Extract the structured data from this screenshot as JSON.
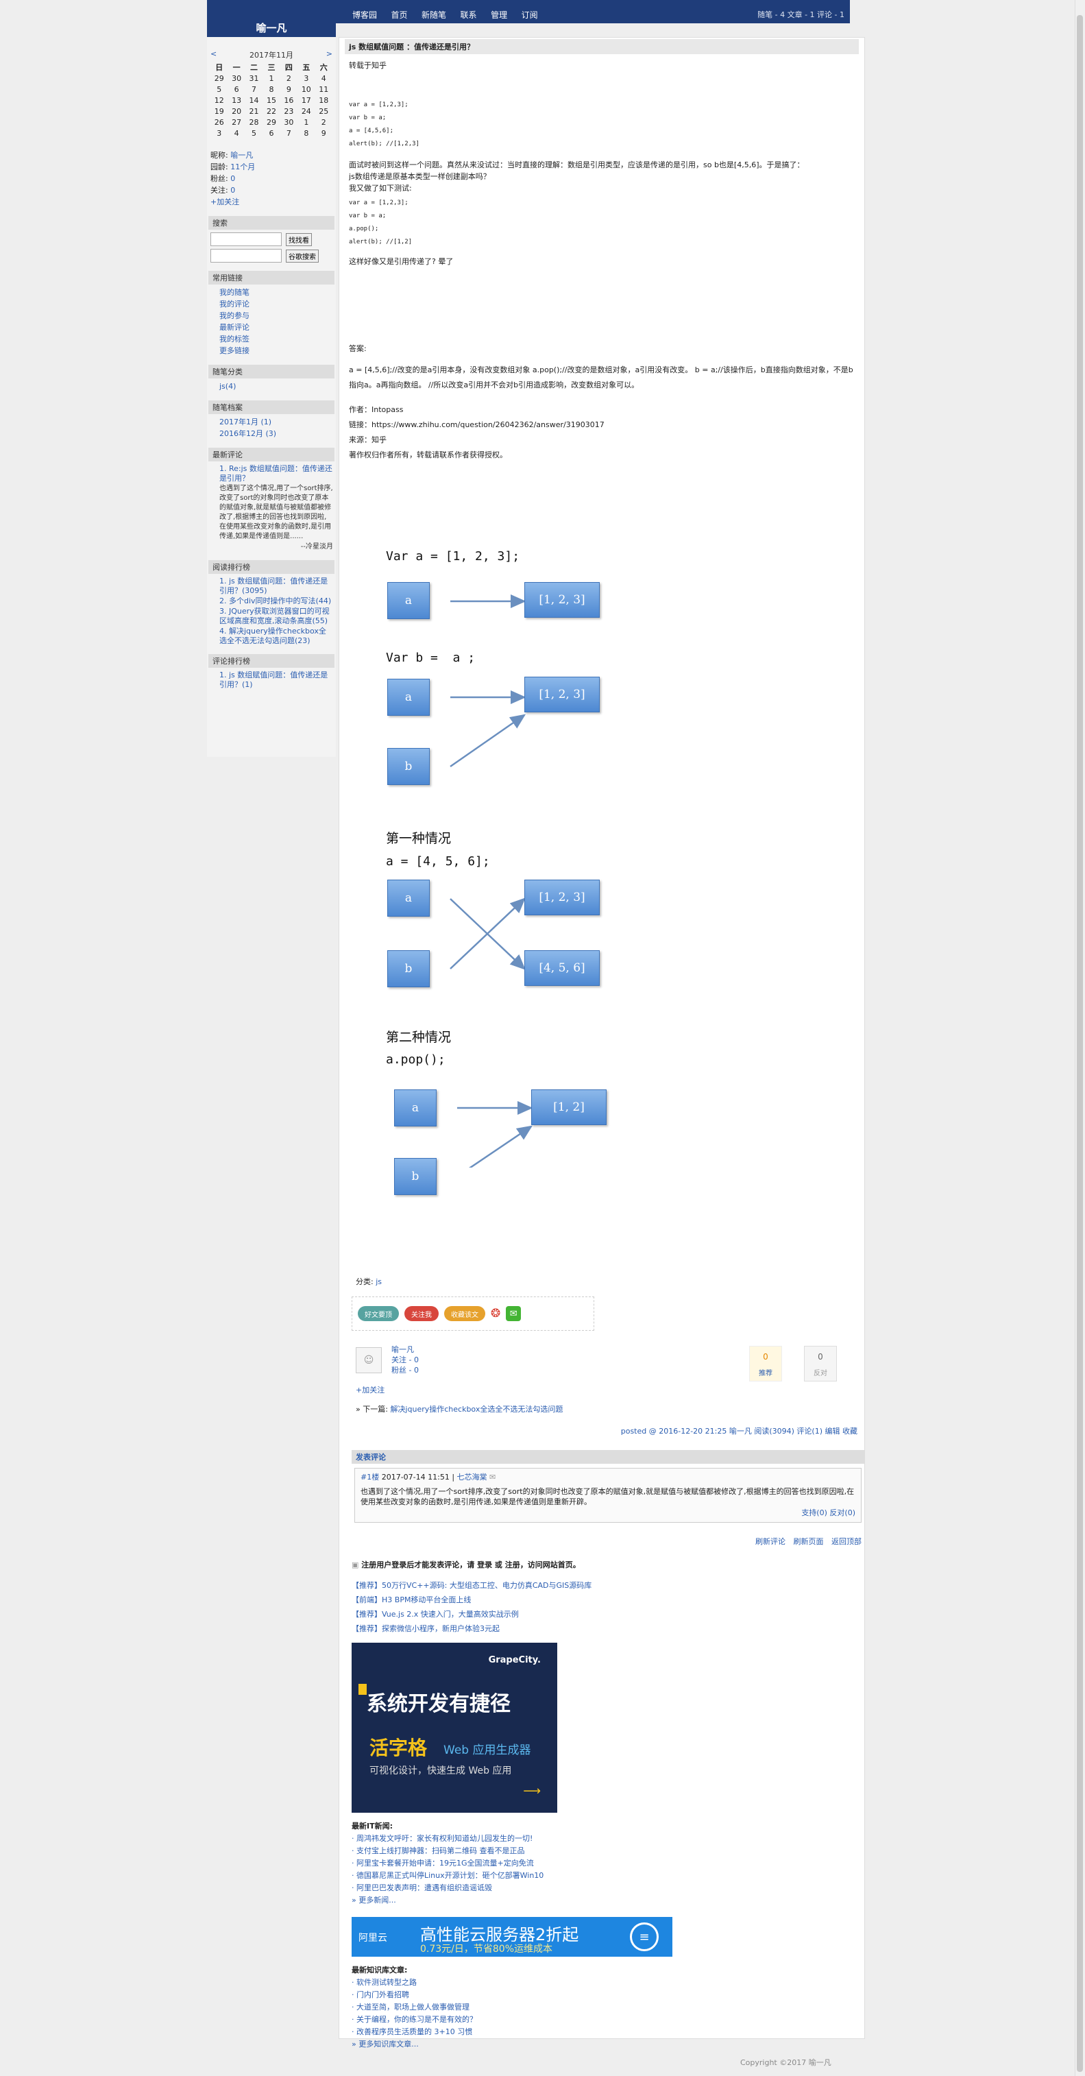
{
  "header": {
    "blog_name": "喻一凡",
    "nav": [
      "博客园",
      "首页",
      "新随笔",
      "联系",
      "管理",
      "订阅"
    ],
    "stats": "随笔 - 4  文章 - 1  评论 - 1"
  },
  "calendar": {
    "prev": "<",
    "next": ">",
    "month": "2017年11月",
    "weekdays": [
      "日",
      "一",
      "二",
      "三",
      "四",
      "五",
      "六"
    ],
    "rows": [
      [
        "29",
        "30",
        "31",
        "1",
        "2",
        "3",
        "4"
      ],
      [
        "5",
        "6",
        "7",
        "8",
        "9",
        "10",
        "11"
      ],
      [
        "12",
        "13",
        "14",
        "15",
        "16",
        "17",
        "18"
      ],
      [
        "19",
        "20",
        "21",
        "22",
        "23",
        "24",
        "25"
      ],
      [
        "26",
        "27",
        "28",
        "29",
        "30",
        "1",
        "2"
      ],
      [
        "3",
        "4",
        "5",
        "6",
        "7",
        "8",
        "9"
      ]
    ]
  },
  "profile": {
    "nick_label": "昵称:",
    "nick": "喻一凡",
    "age_label": "园龄:",
    "age": "11个月",
    "fans_label": "粉丝:",
    "fans": "0",
    "follow_label": "关注:",
    "follow": "0",
    "add_follow": "+加关注"
  },
  "search": {
    "title": "搜索",
    "btn1": "找找看",
    "btn2": "谷歌搜索"
  },
  "links": {
    "title": "常用链接",
    "items": [
      "我的随笔",
      "我的评论",
      "我的参与",
      "最新评论",
      "我的标签",
      "更多链接"
    ]
  },
  "cats": {
    "title": "随笔分类",
    "items": [
      "js(4)"
    ]
  },
  "archive": {
    "title": "随笔档案",
    "items": [
      "2017年1月 (1)",
      "2016年12月 (3)"
    ]
  },
  "recent": {
    "title": "最新评论",
    "link": "1. Re:js 数组赋值问题：值传递还是引用？",
    "text": "也遇到了这个情况,用了一个sort排序,改变了sort的对象同时也改变了原本的赋值对象,就是赋值与被赋值都被修改了,根据博主的回答也找到原因啦,在使用某些改变对象的函数时,是引用传递,如果是传递值则是......",
    "author": "--冷星淡月"
  },
  "top_read": {
    "title": "阅读排行榜",
    "items": [
      "1. js 数组赋值问题：值传递还是引用？(3095)",
      "2. 多个div同时操作中的写法(44)",
      "3. JQuery获取浏览器窗口的可视区域高度和宽度,滚动条高度(55)",
      "4. 解决jquery操作checkbox全选全不选无法勾选问题(23)"
    ]
  },
  "top_comment": {
    "title": "评论排行榜",
    "items": [
      "1. js 数组赋值问题：值传递还是引用？(1)"
    ]
  },
  "post": {
    "title": "js 数组赋值问题 ：值传递还是引用？",
    "source": "转载于知乎",
    "code1": [
      "var a = [1,2,3];",
      "var b = a;",
      "a = [4,5,6];",
      "alert(b);  //[1,2,3]"
    ],
    "para1": "面试时被问到这样一个问题。真然从来没试过：当时直接的理解：数组是引用类型，应该是传递的是引用，so b也是[4,5,6]。于是搞了：",
    "para1b": "js数组传递是原基本类型一样创建副本吗？",
    "para2": "我又做了如下测试:",
    "code2": [
      "var a = [1,2,3];",
      "var b = a;",
      "a.pop();",
      "alert(b);  //[1,2]"
    ],
    "para3": "这样好像又是引用传递了? 晕了",
    "answer_label": "答案:",
    "answer": "a = [4,5,6];//改变的是a引用本身，没有改变数组对象 a.pop();//改变的是数组对象，a引用没有改变。 b = a;//该操作后，b直接指向数组对象，不是b指向a。a再指向数组。 //所以改变a引用并不会对b引用造成影响，改变数组对象可以。",
    "author_line": "作者：Intopass",
    "link_line": "链接：https://www.zhihu.com/question/26042362/answer/31903017",
    "from_line": "来源：知乎",
    "copyright_line": "著作权归作者所有，转载请联系作者获得授权。",
    "category_label": "分类:",
    "category": "js"
  },
  "diagram": {
    "line1": "Var a = [1, 2, 3];",
    "line2": "Var b =  a ;",
    "case1": "第一种情况",
    "case1code": "a = [4, 5, 6];",
    "case2": "第二种情况",
    "case2code": "a.pop();",
    "box_a": "a",
    "box_b": "b",
    "arr1": "[1, 2, 3]",
    "arr2": "[4, 5, 6]",
    "arr3": "[1, 2]"
  },
  "share": {
    "b1": "好文要顶",
    "b2": "关注我",
    "b3": "收藏该文"
  },
  "author": {
    "name": "喻一凡",
    "follow": "关注 - 0",
    "fans": "粉丝 - 0",
    "add": "+加关注",
    "digg": "0",
    "digg_label": "推荐",
    "bury": "0",
    "bury_label": "反对",
    "next_label": "» 下一篇:",
    "next": "解决jquery操作checkbox全选全不选无法勾选问题",
    "posted": "posted @ 2016-12-20 21:25 喻一凡 阅读(3094) 评论(1) 编辑 收藏"
  },
  "comments": {
    "title": "发表评论",
    "floor": "#1楼",
    "date": "2017-07-14 11:51 |",
    "user": "七芯海棠",
    "body": "也遇到了这个情况,用了一个sort排序,改变了sort的对象同时也改变了原本的赋值对象,就是赋值与被赋值都被修改了,根据博主的回答也找到原因啦,在使用某些改变对象的函数时,是引用传递,如果是传递值则是重新开辟。",
    "support": "支持(0)",
    "oppose": "反对(0)"
  },
  "footer": {
    "links": [
      "刷新评论",
      "刷新页面",
      "返回顶部"
    ],
    "notice": "注册用户登录后才能发表评论，请 登录 或 注册，访问网站首页。",
    "ads": [
      "【推荐】50万行VC++源码: 大型组态工控、电力仿真CAD与GIS源码库",
      "【前端】H3 BPM移动平台全面上线",
      "【推荐】Vue.js 2.x 快速入门，大量高效实战示例",
      "【推荐】探索微信小程序，新用户体验3元起"
    ],
    "banner_brand": "GrapeCity.",
    "banner_title": "系统开发有捷径",
    "banner_sub1": "活字格",
    "banner_sub2": "Web 应用生成器",
    "banner_sub3": "可视化设计，快速生成 Web 应用",
    "news_title": "最新IT新闻:",
    "news": [
      "· 周鸿祎发文呼吁：家长有权利知道幼儿园发生的一切!",
      "· 支付宝上线打脚神器：扫码第二维码 查看不是正品",
      "· 阿里宝卡套餐开始申请：19元1G全国流量+定向免流",
      "· 德国慕尼黑正式叫停Linux开源计划：砸个亿部署Win10",
      "· 阿里巴巴发表声明：遭遇有组织造谣诋毁",
      "» 更多新闻..."
    ],
    "banner2_brand": "阿里云",
    "banner2_text": "高性能云服务器2折起",
    "banner2_sub": "0.73元/日，节省80%运维成本",
    "kb_title": "最新知识库文章:",
    "kb": [
      "· 软件测试转型之路",
      "· 门内门外看招聘",
      "· 大道至简，职场上做人做事做管理",
      "· 关于编程，你的练习是不是有效的？",
      "· 改善程序员生活质量的 3+10 习惯",
      "» 更多知识库文章..."
    ],
    "copyright": "Copyright ©2017 喻一凡"
  }
}
